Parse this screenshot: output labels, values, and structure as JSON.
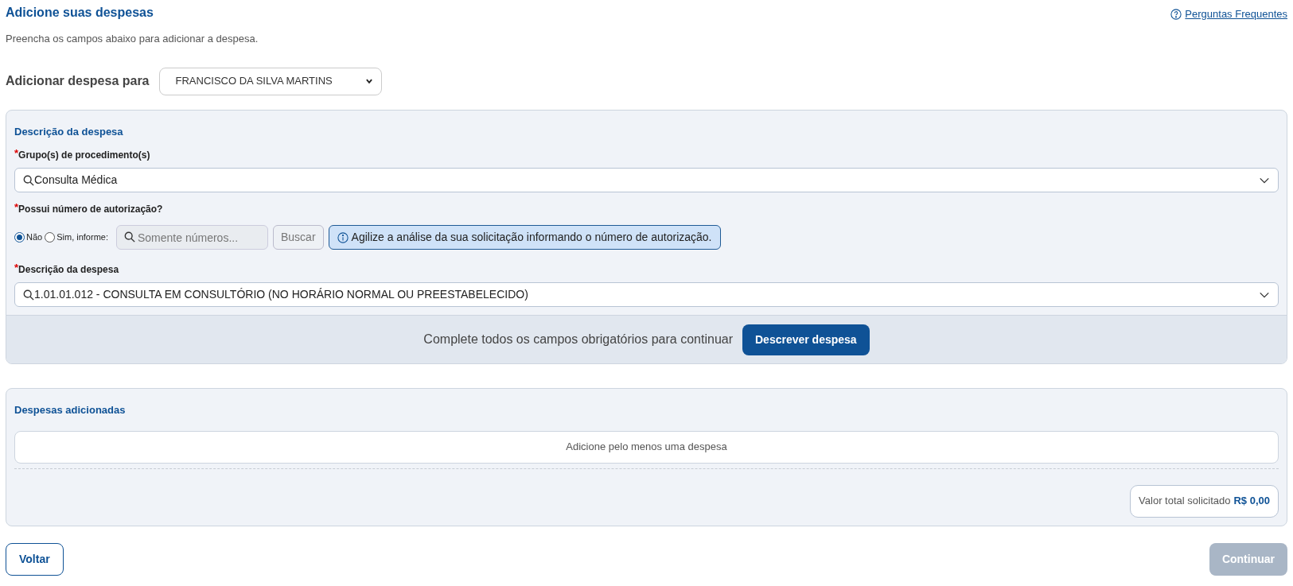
{
  "header": {
    "title": "Adicione suas despesas",
    "subtitle": "Preencha os campos abaixo para adicionar a despesa.",
    "help_link": "Perguntas Frequentes"
  },
  "beneficiary": {
    "label": "Adicionar despesa para",
    "value": "FRANCISCO DA SILVA MARTINS"
  },
  "description_panel": {
    "title": "Descrição da despesa",
    "group_field": {
      "label": "Grupo(s) de procedimento(s)",
      "required_mark": "*",
      "value": "Consulta Médica"
    },
    "authorization": {
      "label": "Possui número de autorização?",
      "required_mark": "*",
      "options": [
        {
          "label": "Não",
          "selected": true
        },
        {
          "label": "Sim, informe:",
          "selected": false
        }
      ],
      "number_field": {
        "placeholder": "Somente números...",
        "disabled": true
      },
      "search_button": {
        "label": "Buscar",
        "disabled": true
      },
      "info": "Agilize a análise da sua solicitação informando o número de autorização."
    },
    "expense_field": {
      "label": "Descrição da despesa",
      "required_mark": "*",
      "value": "1.01.01.012 - CONSULTA EM CONSULTÓRIO (NO HORÁRIO NORMAL OU PREESTABELECIDO)"
    },
    "footer": {
      "message": "Complete todos os campos obrigatórios para continuar",
      "button": "Descrever despesa"
    }
  },
  "added_panel": {
    "title": "Despesas adicionadas",
    "empty_message": "Adicione pelo menos uma despesa",
    "total_label": "Valor total solicitado",
    "total_value": "R$ 0,00"
  },
  "actions": [
    {
      "label": "Voltar",
      "kind": "outline"
    },
    {
      "label": "Continuar",
      "kind": "primary",
      "disabled": true
    }
  ]
}
